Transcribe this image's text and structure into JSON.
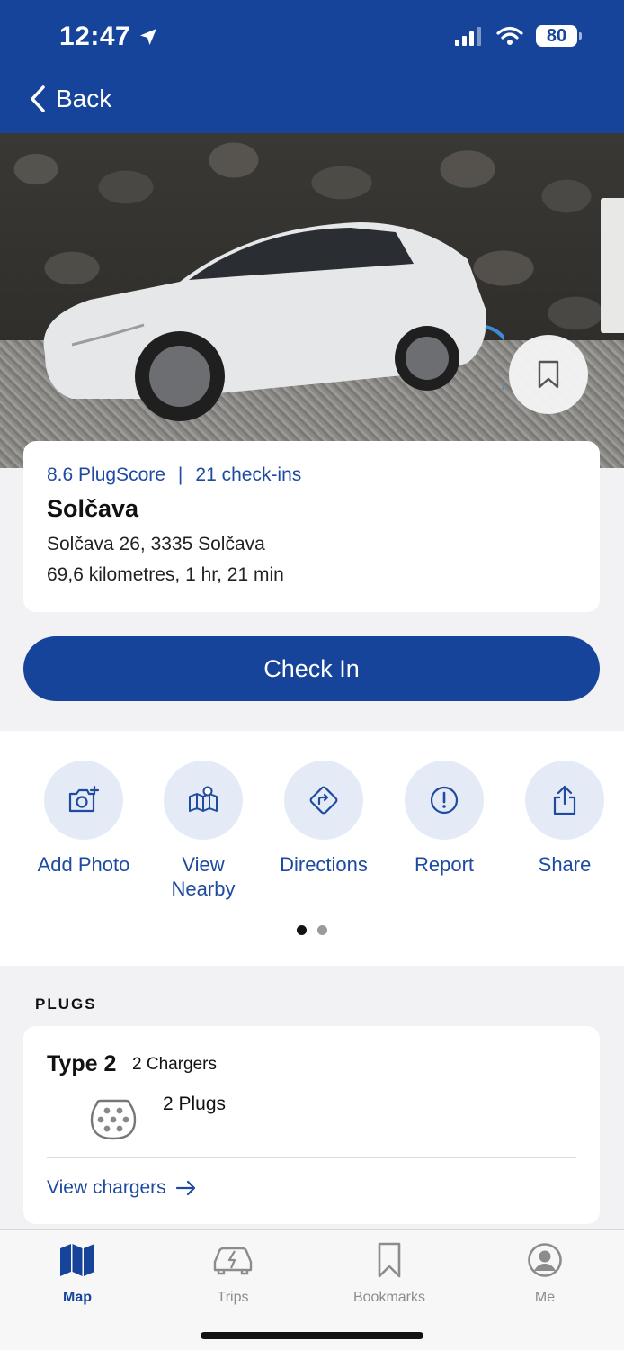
{
  "status_bar": {
    "time": "12:47",
    "battery": "80"
  },
  "nav": {
    "back_label": "Back"
  },
  "station": {
    "plugscore": "8.6 PlugScore",
    "separator": "|",
    "checkins": "21 check-ins",
    "name": "Solčava",
    "address": "Solčava 26, 3335 Solčava",
    "distance": "69,6 kilometres, 1 hr, 21 min"
  },
  "checkin_label": "Check In",
  "actions": [
    {
      "label": "Add Photo",
      "icon": "camera-plus-icon"
    },
    {
      "label": "View Nearby",
      "icon": "map-pin-icon"
    },
    {
      "label": "Directions",
      "icon": "directions-icon"
    },
    {
      "label": "Report",
      "icon": "alert-circle-icon"
    },
    {
      "label": "Share",
      "icon": "share-icon"
    }
  ],
  "pagination": {
    "pages": 2,
    "active": 1
  },
  "plugs": {
    "heading": "PLUGS",
    "items": [
      {
        "type": "Type 2",
        "chargers": "2 Chargers",
        "plugs": "2 Plugs",
        "icon": "type2-plug-icon"
      }
    ],
    "view_chargers": "View chargers"
  },
  "tabbar": [
    {
      "label": "Map",
      "icon": "map-icon",
      "active": true
    },
    {
      "label": "Trips",
      "icon": "car-charge-icon",
      "active": false
    },
    {
      "label": "Bookmarks",
      "icon": "bookmark-icon",
      "active": false
    },
    {
      "label": "Me",
      "icon": "profile-icon",
      "active": false
    }
  ],
  "colors": {
    "brand": "#17449b",
    "link": "#1e4aa0",
    "action_bg": "#e4ebf7"
  }
}
